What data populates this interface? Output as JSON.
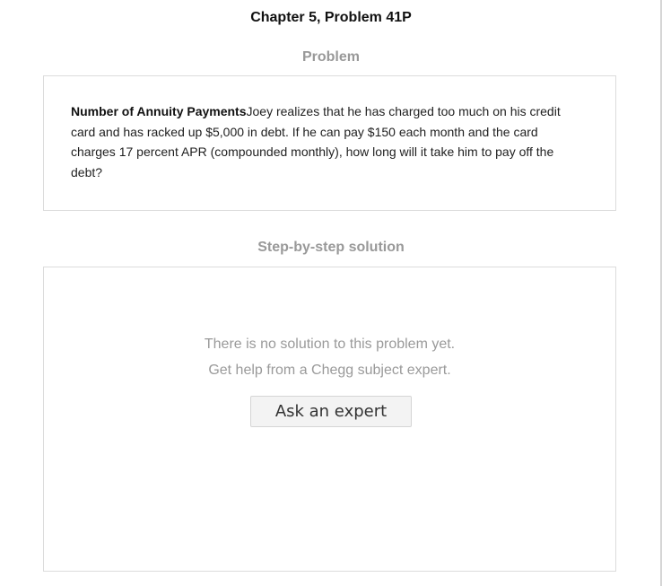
{
  "chapter_title": "Chapter 5, Problem 41P",
  "problem": {
    "heading": "Problem",
    "title": "Number of Annuity Payments",
    "body": "Joey realizes that he has charged too much on his credit card and has racked up $5,000 in debt.  If he can pay $150 each month and the card charges 17 percent APR (compounded monthly), how long will it take him to pay off the debt?"
  },
  "solution": {
    "heading": "Step-by-step solution",
    "empty_line1": "There is no solution to this problem yet.",
    "empty_line2": "Get help from a Chegg subject expert.",
    "ask_button": "Ask an expert"
  }
}
